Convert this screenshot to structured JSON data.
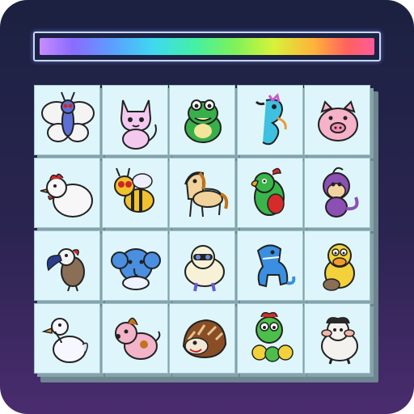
{
  "timer": {
    "remaining_fraction": 0.99
  },
  "board": {
    "rows": 4,
    "cols": 5,
    "tiles": [
      [
        "butterfly-icon",
        "cat-icon",
        "frog-icon",
        "seahorse-icon",
        "pig-icon"
      ],
      [
        "chicken-icon",
        "bee-icon",
        "horse-icon",
        "parrot-icon",
        "monkey-icon"
      ],
      [
        "toucan-icon",
        "elephant-icon",
        "sheep-icon",
        "dinosaur-icon",
        "duck-icon"
      ],
      [
        "goose-icon",
        "dog-icon",
        "hedgehog-icon",
        "caterpillar-icon",
        "ram-icon"
      ]
    ]
  },
  "colors": {
    "background_top": "#1b2141",
    "background_bottom": "#4a2c6e",
    "tile_face": "#def6fb",
    "tile_side": "#86a2aa"
  }
}
